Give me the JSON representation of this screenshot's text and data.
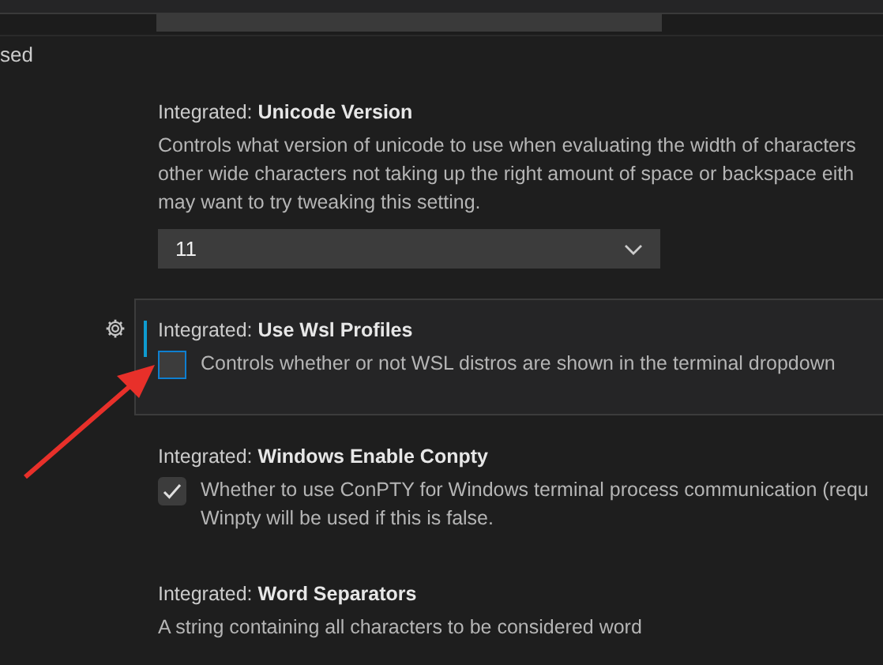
{
  "sidebar": {
    "items": [
      {
        "label": "sed"
      }
    ]
  },
  "settings": [
    {
      "kind": "dropdown",
      "category": "Integrated:",
      "name": "Unicode Version",
      "description": "Controls what version of unicode to use when evaluating the width of characters\nother wide characters not taking up the right amount of space or backspace eith\nmay want to try tweaking this setting.",
      "value": "11",
      "focused": false
    },
    {
      "kind": "checkbox",
      "category": "Integrated:",
      "name": "Use Wsl Profiles",
      "description": "Controls whether or not WSL distros are shown in the terminal dropdown",
      "checked": false,
      "focused": true
    },
    {
      "kind": "checkbox",
      "category": "Integrated:",
      "name": "Windows Enable Conpty",
      "description": "Whether to use ConPTY for Windows terminal process communication (requ\nWinpty will be used if this is false.",
      "checked": true,
      "focused": false
    },
    {
      "kind": "text",
      "category": "Integrated:",
      "name": "Word Separators",
      "description": "A string containing all characters to be considered word",
      "focused": false
    }
  ]
}
